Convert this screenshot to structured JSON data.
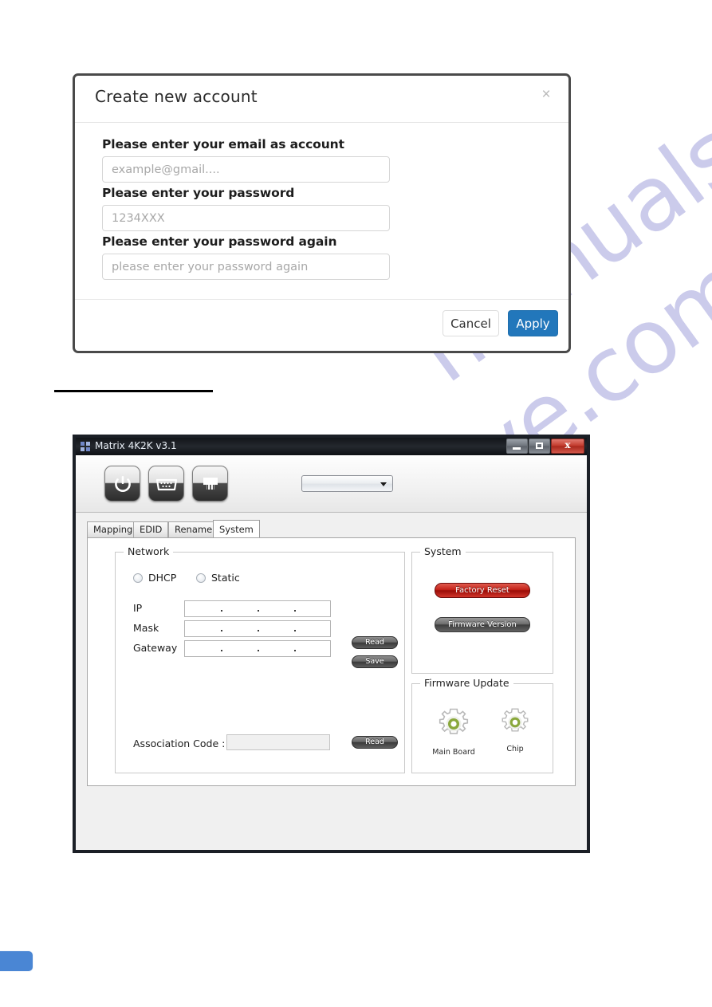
{
  "watermark": {
    "line1": "manualshive.com",
    "line2": "manualshive.com",
    "color": "#c9c9ea"
  },
  "dialog": {
    "title": "Create new account",
    "close_icon": "close-icon",
    "close_glyph": "×",
    "fields": [
      {
        "label": "Please enter your email as account",
        "placeholder": "example@gmail....",
        "value": ""
      },
      {
        "label": "Please enter your password",
        "placeholder": "1234XXX",
        "value": ""
      },
      {
        "label": "Please enter your password again",
        "placeholder": "please enter your password again",
        "value": ""
      }
    ],
    "cancel_label": "Cancel",
    "apply_label": "Apply",
    "apply_color": "#2277bb"
  },
  "app": {
    "title": "Matrix 4K2K v3.1",
    "window_buttons": {
      "minimize": "minimize-icon",
      "maximize": "maximize-icon",
      "close": "close-icon",
      "close_glyph": "x"
    },
    "toolbar": {
      "buttons": [
        {
          "name": "power-icon"
        },
        {
          "name": "serial-port-icon"
        },
        {
          "name": "ethernet-port-icon"
        }
      ],
      "combo_value": "",
      "combo_arrow": "chevron-down-icon"
    },
    "tabs": [
      {
        "label": "Mapping",
        "active": false
      },
      {
        "label": "EDID",
        "active": false
      },
      {
        "label": "Rename",
        "active": false
      },
      {
        "label": "System",
        "active": true
      }
    ],
    "network": {
      "group_title": "Network",
      "mode_options": [
        {
          "label": "DHCP",
          "selected": false
        },
        {
          "label": "Static",
          "selected": false
        }
      ],
      "rows": [
        {
          "label": "IP",
          "value": ""
        },
        {
          "label": "Mask",
          "value": ""
        },
        {
          "label": "Gateway",
          "value": ""
        }
      ],
      "read_label": "Read",
      "save_label": "Save",
      "association_label": "Association Code :",
      "association_value": "",
      "association_read_label": "Read"
    },
    "system": {
      "group_title": "System",
      "factory_reset_label": "Factory Reset",
      "factory_reset_color": "#c32118",
      "firmware_version_label": "Firmware Version"
    },
    "firmware_update": {
      "group_title": "Firmware Update",
      "items": [
        {
          "label": "Main Board",
          "icon": "gear-icon"
        },
        {
          "label": "Chip",
          "icon": "gear-icon"
        }
      ],
      "gear_accent": "#8aa83c"
    }
  }
}
